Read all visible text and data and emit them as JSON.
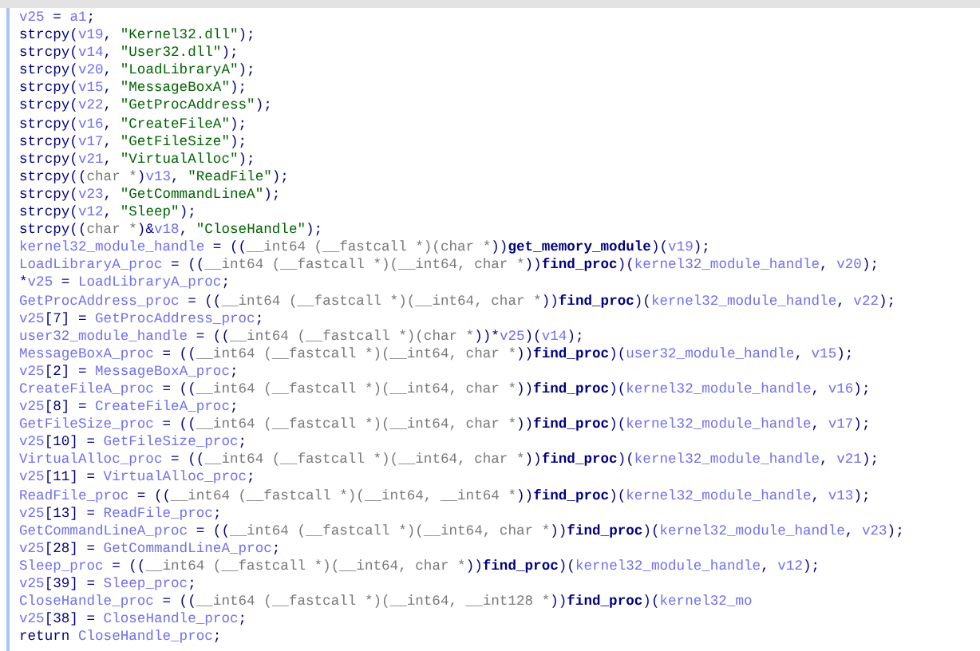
{
  "code_lines": [
    [
      {
        "kind": "v",
        "text": "v25"
      },
      {
        "kind": "p",
        "text": " = "
      },
      {
        "kind": "v",
        "text": "a1"
      },
      {
        "kind": "p",
        "text": ";"
      }
    ],
    [
      {
        "kind": "p",
        "text": "strcpy("
      },
      {
        "kind": "v",
        "text": "v19"
      },
      {
        "kind": "p",
        "text": ", "
      },
      {
        "kind": "s",
        "text": "\"Kernel32.dll\""
      },
      {
        "kind": "p",
        "text": ");"
      }
    ],
    [
      {
        "kind": "p",
        "text": "strcpy("
      },
      {
        "kind": "v",
        "text": "v14"
      },
      {
        "kind": "p",
        "text": ", "
      },
      {
        "kind": "s",
        "text": "\"User32.dll\""
      },
      {
        "kind": "p",
        "text": ");"
      }
    ],
    [
      {
        "kind": "p",
        "text": "strcpy("
      },
      {
        "kind": "v",
        "text": "v20"
      },
      {
        "kind": "p",
        "text": ", "
      },
      {
        "kind": "s",
        "text": "\"LoadLibraryA\""
      },
      {
        "kind": "p",
        "text": ");"
      }
    ],
    [
      {
        "kind": "p",
        "text": "strcpy("
      },
      {
        "kind": "v",
        "text": "v15"
      },
      {
        "kind": "p",
        "text": ", "
      },
      {
        "kind": "s",
        "text": "\"MessageBoxA\""
      },
      {
        "kind": "p",
        "text": ");"
      }
    ],
    [
      {
        "kind": "p",
        "text": "strcpy("
      },
      {
        "kind": "v",
        "text": "v22"
      },
      {
        "kind": "p",
        "text": ", "
      },
      {
        "kind": "s",
        "text": "\"GetProcAddress\""
      },
      {
        "kind": "p",
        "text": ");"
      }
    ],
    [
      {
        "kind": "p",
        "text": "strcpy("
      },
      {
        "kind": "v",
        "text": "v16"
      },
      {
        "kind": "p",
        "text": ", "
      },
      {
        "kind": "s",
        "text": "\"CreateFileA\""
      },
      {
        "kind": "p",
        "text": ");"
      }
    ],
    [
      {
        "kind": "p",
        "text": "strcpy("
      },
      {
        "kind": "v",
        "text": "v17"
      },
      {
        "kind": "p",
        "text": ", "
      },
      {
        "kind": "s",
        "text": "\"GetFileSize\""
      },
      {
        "kind": "p",
        "text": ");"
      }
    ],
    [
      {
        "kind": "p",
        "text": "strcpy("
      },
      {
        "kind": "v",
        "text": "v21"
      },
      {
        "kind": "p",
        "text": ", "
      },
      {
        "kind": "s",
        "text": "\"VirtualAlloc\""
      },
      {
        "kind": "p",
        "text": ");"
      }
    ],
    [
      {
        "kind": "p",
        "text": "strcpy(("
      },
      {
        "kind": "t",
        "text": "char *"
      },
      {
        "kind": "p",
        "text": ")"
      },
      {
        "kind": "v",
        "text": "v13"
      },
      {
        "kind": "p",
        "text": ", "
      },
      {
        "kind": "s",
        "text": "\"ReadFile\""
      },
      {
        "kind": "p",
        "text": ");"
      }
    ],
    [
      {
        "kind": "p",
        "text": "strcpy("
      },
      {
        "kind": "v",
        "text": "v23"
      },
      {
        "kind": "p",
        "text": ", "
      },
      {
        "kind": "s",
        "text": "\"GetCommandLineA\""
      },
      {
        "kind": "p",
        "text": ");"
      }
    ],
    [
      {
        "kind": "p",
        "text": "strcpy("
      },
      {
        "kind": "v",
        "text": "v12"
      },
      {
        "kind": "p",
        "text": ", "
      },
      {
        "kind": "s",
        "text": "\"Sleep\""
      },
      {
        "kind": "p",
        "text": ");"
      }
    ],
    [
      {
        "kind": "p",
        "text": "strcpy(("
      },
      {
        "kind": "t",
        "text": "char *"
      },
      {
        "kind": "p",
        "text": ")&"
      },
      {
        "kind": "v",
        "text": "v18"
      },
      {
        "kind": "p",
        "text": ", "
      },
      {
        "kind": "s",
        "text": "\"CloseHandle\""
      },
      {
        "kind": "p",
        "text": ");"
      }
    ],
    [
      {
        "kind": "v",
        "text": "kernel32_module_handle"
      },
      {
        "kind": "p",
        "text": " = (("
      },
      {
        "kind": "t",
        "text": "__int64 (__fastcall *)(char *"
      },
      {
        "kind": "p",
        "text": "))"
      },
      {
        "kind": "f",
        "text": "get_memory_module"
      },
      {
        "kind": "p",
        "text": ")("
      },
      {
        "kind": "v",
        "text": "v19"
      },
      {
        "kind": "p",
        "text": ");"
      }
    ],
    [
      {
        "kind": "v",
        "text": "LoadLibraryA_proc"
      },
      {
        "kind": "p",
        "text": " = (("
      },
      {
        "kind": "t",
        "text": "__int64 (__fastcall *)(__int64, char *"
      },
      {
        "kind": "p",
        "text": "))"
      },
      {
        "kind": "f",
        "text": "find_proc"
      },
      {
        "kind": "p",
        "text": ")("
      },
      {
        "kind": "v",
        "text": "kernel32_module_handle"
      },
      {
        "kind": "p",
        "text": ", "
      },
      {
        "kind": "v",
        "text": "v20"
      },
      {
        "kind": "p",
        "text": ");"
      }
    ],
    [
      {
        "kind": "p",
        "text": "*"
      },
      {
        "kind": "v",
        "text": "v25"
      },
      {
        "kind": "p",
        "text": " = "
      },
      {
        "kind": "v",
        "text": "LoadLibraryA_proc"
      },
      {
        "kind": "p",
        "text": ";"
      }
    ],
    [
      {
        "kind": "v",
        "text": "GetProcAddress_proc"
      },
      {
        "kind": "p",
        "text": " = (("
      },
      {
        "kind": "t",
        "text": "__int64 (__fastcall *)(__int64, char *"
      },
      {
        "kind": "p",
        "text": "))"
      },
      {
        "kind": "f",
        "text": "find_proc"
      },
      {
        "kind": "p",
        "text": ")("
      },
      {
        "kind": "v",
        "text": "kernel32_module_handle"
      },
      {
        "kind": "p",
        "text": ", "
      },
      {
        "kind": "v",
        "text": "v22"
      },
      {
        "kind": "p",
        "text": ");"
      }
    ],
    [
      {
        "kind": "v",
        "text": "v25"
      },
      {
        "kind": "p",
        "text": "[7] = "
      },
      {
        "kind": "v",
        "text": "GetProcAddress_proc"
      },
      {
        "kind": "p",
        "text": ";"
      }
    ],
    [
      {
        "kind": "v",
        "text": "user32_module_handle"
      },
      {
        "kind": "p",
        "text": " = (("
      },
      {
        "kind": "t",
        "text": "__int64 (__fastcall *)(char *"
      },
      {
        "kind": "p",
        "text": "))*"
      },
      {
        "kind": "v",
        "text": "v25"
      },
      {
        "kind": "p",
        "text": ")("
      },
      {
        "kind": "v",
        "text": "v14"
      },
      {
        "kind": "p",
        "text": ");"
      }
    ],
    [
      {
        "kind": "v",
        "text": "MessageBoxA_proc"
      },
      {
        "kind": "p",
        "text": " = (("
      },
      {
        "kind": "t",
        "text": "__int64 (__fastcall *)(__int64, char *"
      },
      {
        "kind": "p",
        "text": "))"
      },
      {
        "kind": "f",
        "text": "find_proc"
      },
      {
        "kind": "p",
        "text": ")("
      },
      {
        "kind": "v",
        "text": "user32_module_handle"
      },
      {
        "kind": "p",
        "text": ", "
      },
      {
        "kind": "v",
        "text": "v15"
      },
      {
        "kind": "p",
        "text": ");"
      }
    ],
    [
      {
        "kind": "v",
        "text": "v25"
      },
      {
        "kind": "p",
        "text": "[2] = "
      },
      {
        "kind": "v",
        "text": "MessageBoxA_proc"
      },
      {
        "kind": "p",
        "text": ";"
      }
    ],
    [
      {
        "kind": "v",
        "text": "CreateFileA_proc"
      },
      {
        "kind": "p",
        "text": " = (("
      },
      {
        "kind": "t",
        "text": "__int64 (__fastcall *)(__int64, char *"
      },
      {
        "kind": "p",
        "text": "))"
      },
      {
        "kind": "f",
        "text": "find_proc"
      },
      {
        "kind": "p",
        "text": ")("
      },
      {
        "kind": "v",
        "text": "kernel32_module_handle"
      },
      {
        "kind": "p",
        "text": ", "
      },
      {
        "kind": "v",
        "text": "v16"
      },
      {
        "kind": "p",
        "text": ");"
      }
    ],
    [
      {
        "kind": "v",
        "text": "v25"
      },
      {
        "kind": "p",
        "text": "[8] = "
      },
      {
        "kind": "v",
        "text": "CreateFileA_proc"
      },
      {
        "kind": "p",
        "text": ";"
      }
    ],
    [
      {
        "kind": "v",
        "text": "GetFileSize_proc"
      },
      {
        "kind": "p",
        "text": " = (("
      },
      {
        "kind": "t",
        "text": "__int64 (__fastcall *)(__int64, char *"
      },
      {
        "kind": "p",
        "text": "))"
      },
      {
        "kind": "f",
        "text": "find_proc"
      },
      {
        "kind": "p",
        "text": ")("
      },
      {
        "kind": "v",
        "text": "kernel32_module_handle"
      },
      {
        "kind": "p",
        "text": ", "
      },
      {
        "kind": "v",
        "text": "v17"
      },
      {
        "kind": "p",
        "text": ");"
      }
    ],
    [
      {
        "kind": "v",
        "text": "v25"
      },
      {
        "kind": "p",
        "text": "[10] = "
      },
      {
        "kind": "v",
        "text": "GetFileSize_proc"
      },
      {
        "kind": "p",
        "text": ";"
      }
    ],
    [
      {
        "kind": "v",
        "text": "VirtualAlloc_proc"
      },
      {
        "kind": "p",
        "text": " = (("
      },
      {
        "kind": "t",
        "text": "__int64 (__fastcall *)(__int64, char *"
      },
      {
        "kind": "p",
        "text": "))"
      },
      {
        "kind": "f",
        "text": "find_proc"
      },
      {
        "kind": "p",
        "text": ")("
      },
      {
        "kind": "v",
        "text": "kernel32_module_handle"
      },
      {
        "kind": "p",
        "text": ", "
      },
      {
        "kind": "v",
        "text": "v21"
      },
      {
        "kind": "p",
        "text": ");"
      }
    ],
    [
      {
        "kind": "v",
        "text": "v25"
      },
      {
        "kind": "p",
        "text": "[11] = "
      },
      {
        "kind": "v",
        "text": "VirtualAlloc_proc"
      },
      {
        "kind": "p",
        "text": ";"
      }
    ],
    [
      {
        "kind": "v",
        "text": "ReadFile_proc"
      },
      {
        "kind": "p",
        "text": " = (("
      },
      {
        "kind": "t",
        "text": "__int64 (__fastcall *)(__int64, __int64 *"
      },
      {
        "kind": "p",
        "text": "))"
      },
      {
        "kind": "f",
        "text": "find_proc"
      },
      {
        "kind": "p",
        "text": ")("
      },
      {
        "kind": "v",
        "text": "kernel32_module_handle"
      },
      {
        "kind": "p",
        "text": ", "
      },
      {
        "kind": "v",
        "text": "v13"
      },
      {
        "kind": "p",
        "text": ");"
      }
    ],
    [
      {
        "kind": "v",
        "text": "v25"
      },
      {
        "kind": "p",
        "text": "[13] = "
      },
      {
        "kind": "v",
        "text": "ReadFile_proc"
      },
      {
        "kind": "p",
        "text": ";"
      }
    ],
    [
      {
        "kind": "v",
        "text": "GetCommandLineA_proc"
      },
      {
        "kind": "p",
        "text": " = (("
      },
      {
        "kind": "t",
        "text": "__int64 (__fastcall *)(__int64, char *"
      },
      {
        "kind": "p",
        "text": "))"
      },
      {
        "kind": "f",
        "text": "find_proc"
      },
      {
        "kind": "p",
        "text": ")("
      },
      {
        "kind": "v",
        "text": "kernel32_module_handle"
      },
      {
        "kind": "p",
        "text": ", "
      },
      {
        "kind": "v",
        "text": "v23"
      },
      {
        "kind": "p",
        "text": ");"
      }
    ],
    [
      {
        "kind": "v",
        "text": "v25"
      },
      {
        "kind": "p",
        "text": "[28] = "
      },
      {
        "kind": "v",
        "text": "GetCommandLineA_proc"
      },
      {
        "kind": "p",
        "text": ";"
      }
    ],
    [
      {
        "kind": "v",
        "text": "Sleep_proc"
      },
      {
        "kind": "p",
        "text": " = (("
      },
      {
        "kind": "t",
        "text": "__int64 (__fastcall *)(__int64, char *"
      },
      {
        "kind": "p",
        "text": "))"
      },
      {
        "kind": "f",
        "text": "find_proc"
      },
      {
        "kind": "p",
        "text": ")("
      },
      {
        "kind": "v",
        "text": "kernel32_module_handle"
      },
      {
        "kind": "p",
        "text": ", "
      },
      {
        "kind": "v",
        "text": "v12"
      },
      {
        "kind": "p",
        "text": ");"
      }
    ],
    [
      {
        "kind": "v",
        "text": "v25"
      },
      {
        "kind": "p",
        "text": "[39] = "
      },
      {
        "kind": "v",
        "text": "Sleep_proc"
      },
      {
        "kind": "p",
        "text": ";"
      }
    ],
    [
      {
        "kind": "v",
        "text": "CloseHandle_proc"
      },
      {
        "kind": "p",
        "text": " = (("
      },
      {
        "kind": "t",
        "text": "__int64 (__fastcall *)(__int64, __int128 *"
      },
      {
        "kind": "p",
        "text": "))"
      },
      {
        "kind": "f",
        "text": "find_proc"
      },
      {
        "kind": "p",
        "text": ")("
      },
      {
        "kind": "v",
        "text": "kernel32_mo"
      }
    ],
    [
      {
        "kind": "v",
        "text": "v25"
      },
      {
        "kind": "p",
        "text": "[38] = "
      },
      {
        "kind": "v",
        "text": "CloseHandle_proc"
      },
      {
        "kind": "p",
        "text": ";"
      }
    ],
    [
      {
        "kind": "p",
        "text": "return "
      },
      {
        "kind": "v",
        "text": "CloseHandle_proc"
      },
      {
        "kind": "p",
        "text": ";"
      }
    ]
  ]
}
